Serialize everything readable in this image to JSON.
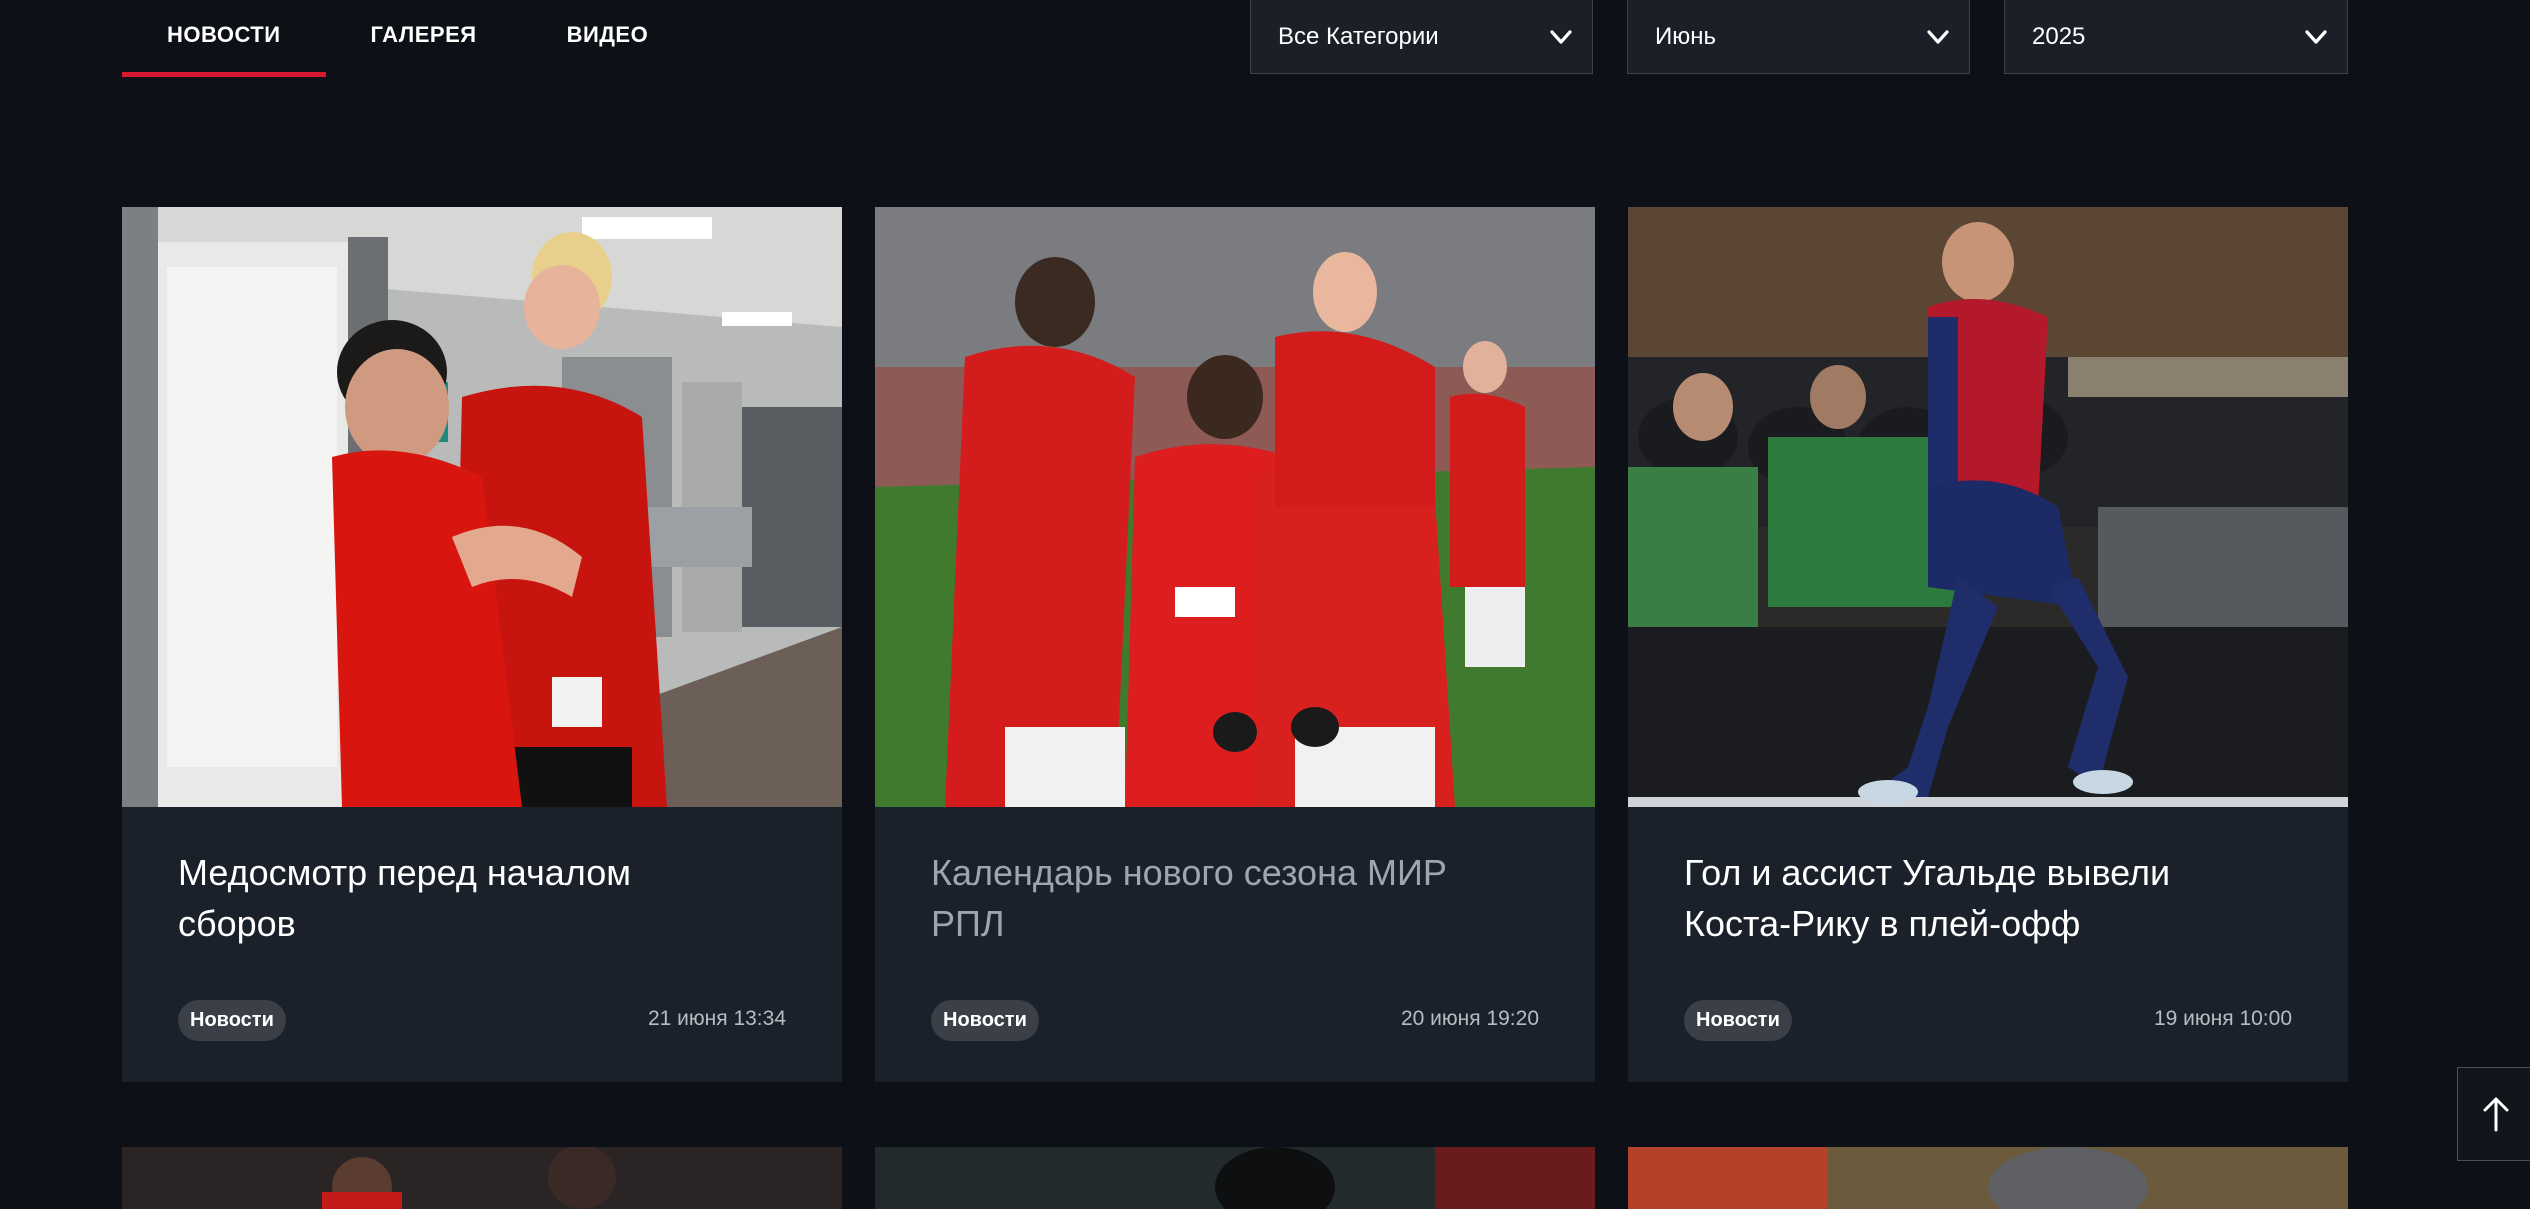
{
  "tabs": [
    {
      "label": "НОВОСТИ",
      "active": true
    },
    {
      "label": "ГАЛЕРЕЯ",
      "active": false
    },
    {
      "label": "ВИДЕО",
      "active": false
    }
  ],
  "filters": {
    "category": "Все Категории",
    "month": "Июнь",
    "year": "2025"
  },
  "cards": [
    {
      "title": "Медосмотр перед началом сборов",
      "tag": "Новости",
      "date": "21 июня 13:34",
      "image": "players-hugging-in-clinic-corridor"
    },
    {
      "title": "Календарь нового сезона МИР РПЛ",
      "tag": "Новости",
      "date": "20 июня 19:20",
      "image": "team-celebrating-goal-on-pitch"
    },
    {
      "title": "Гол и ассист Угальде вывели Коста-Рику в плей-офф",
      "tag": "Новости",
      "date": "19 июня 10:00",
      "image": "player-jumping-celebration-stadium"
    }
  ],
  "colors": {
    "background": "#0d1016",
    "card": "#1b212b",
    "accent": "#d7172f",
    "badge": "#3a3f48"
  },
  "icons": {
    "dropdown": "chevron-down-icon",
    "scroll_top": "arrow-up-icon"
  }
}
